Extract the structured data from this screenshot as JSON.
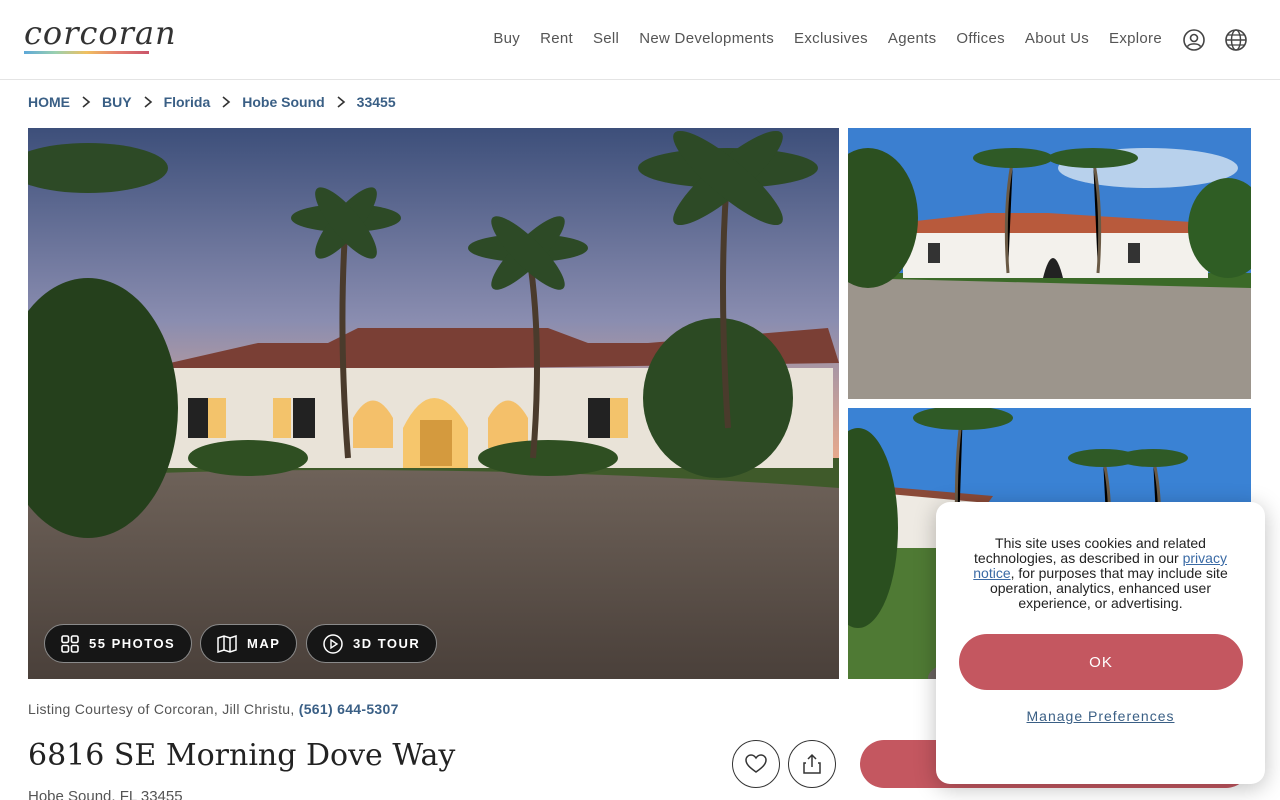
{
  "header": {
    "logo_text": "corcoran",
    "nav": [
      "Buy",
      "Rent",
      "Sell",
      "New Developments",
      "Exclusives",
      "Agents",
      "Offices",
      "About Us",
      "Explore"
    ],
    "icons": [
      "user-account-icon",
      "globe-icon"
    ]
  },
  "breadcrumb": [
    "HOME",
    "BUY",
    "Florida",
    "Hobe Sound",
    "33455"
  ],
  "gallery": {
    "photos_label": "55 PHOTOS",
    "map_label": "MAP",
    "tour_label": "3D TOUR"
  },
  "listing": {
    "courtesy_prefix": "Listing Courtesy of Corcoran, Jill Christu, ",
    "courtesy_phone": "(561) 644-5307",
    "address": "6816 SE Morning Dove Way",
    "city_line": "Hobe Sound, FL 33455"
  },
  "cookie": {
    "text_before": "This site uses cookies and related technologies, as described in our ",
    "link_text": "privacy notice",
    "text_after": ", for purposes that may include site operation, analytics, enhanced user experience, or advertising.",
    "ok_label": "OK",
    "manage_label": "Manage Preferences"
  },
  "colors": {
    "accent": "#c45760",
    "link": "#3a5f85"
  }
}
